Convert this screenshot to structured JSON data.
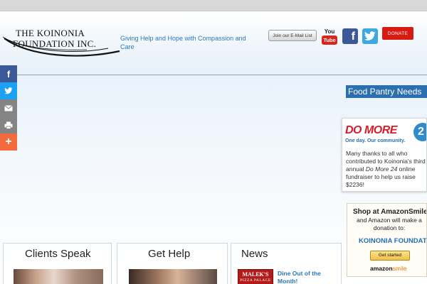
{
  "logo": {
    "line1": "THE KOINONIA",
    "line2": "FOUNDATION INC."
  },
  "tagline": "Giving Help and Hope with Compassion and Care",
  "header": {
    "email_button": "Join our E-Mail List",
    "youtube": {
      "top": "You",
      "bottom": "Tube"
    },
    "facebook_glyph": "f",
    "donate_button": "DONATE"
  },
  "share_bar": {
    "facebook_glyph": "f",
    "more_glyph": "+"
  },
  "sidebar": {
    "food_pantry": "Food Pantry Needs",
    "domore": {
      "logo": "DO MORE",
      "circle": "2",
      "tagline": "One day.  Our community.",
      "text_pre": "Many thanks to all who contributed to Koinonia's third annual ",
      "text_em": "Do More 24",
      "text_post": " online fundraiser to help us raise $2236!"
    },
    "amazon": {
      "title": "Shop at AmazonSmile",
      "subtitle": "and Amazon will make a donation to:",
      "org": "KOINONIA FOUNDATION",
      "start_button": "Get started",
      "logo_word": "amazon",
      "logo_suffix": "smile"
    }
  },
  "panels": {
    "clients_speak": "Clients Speak",
    "get_help": "Get Help",
    "news": "News",
    "maleks": {
      "name": "MALEK'S",
      "sub": "PIZZA PALACE"
    },
    "news_headline": "Dine Out of the Month!"
  },
  "colors": {
    "accent_blue": "#2a78b8",
    "donate_red": "#d81b12",
    "food_pantry_bg": "#2c6fae"
  }
}
